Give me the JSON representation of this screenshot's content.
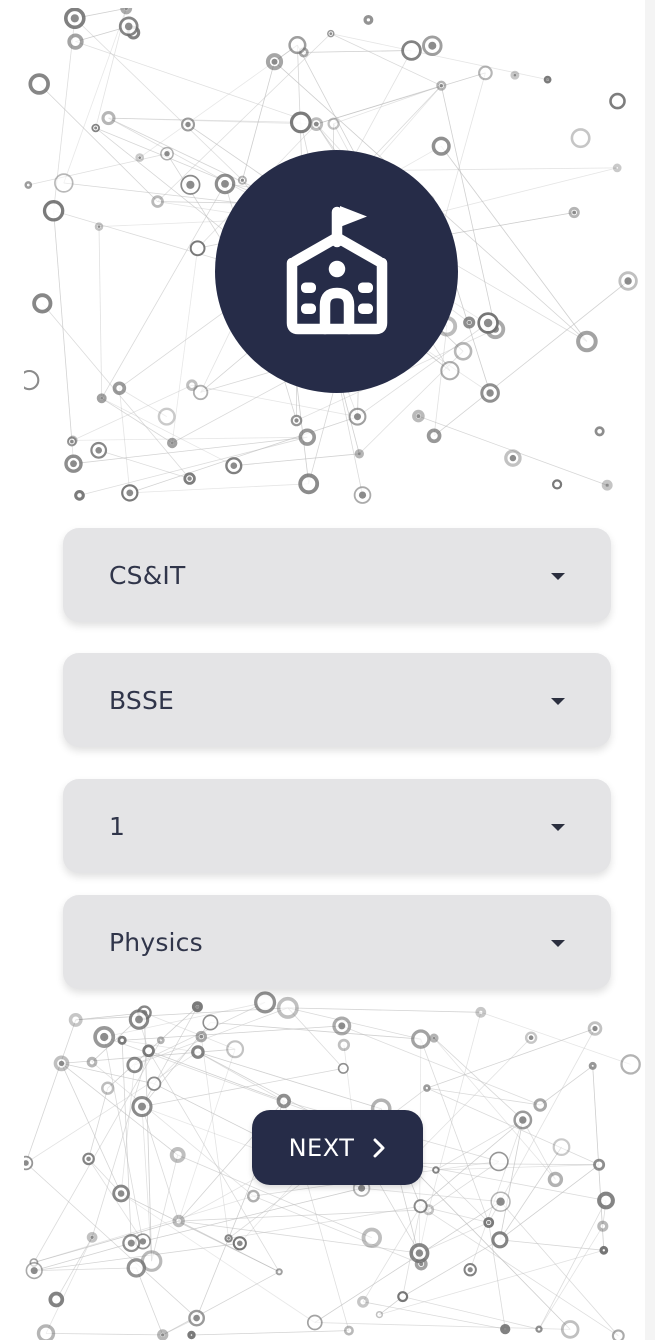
{
  "background": {
    "style": "network-graph-pattern",
    "node_color": "#6f6f6f",
    "line_color": "#bdbdbd"
  },
  "logo": {
    "icon": "school-building-icon",
    "circle_color": "#262c48",
    "icon_color": "#ffffff"
  },
  "form": {
    "dropdowns": [
      {
        "value": "CS&IT",
        "icon": "caret-down-icon"
      },
      {
        "value": "BSSE",
        "icon": "caret-down-icon"
      },
      {
        "value": "1",
        "icon": "caret-down-icon"
      },
      {
        "value": "Physics",
        "icon": "caret-down-icon"
      }
    ],
    "field_color": "#e4e4e6",
    "text_color": "#30354a"
  },
  "next_button": {
    "label": "NEXT",
    "icon": "chevron-right-icon",
    "color": "#262c48"
  }
}
